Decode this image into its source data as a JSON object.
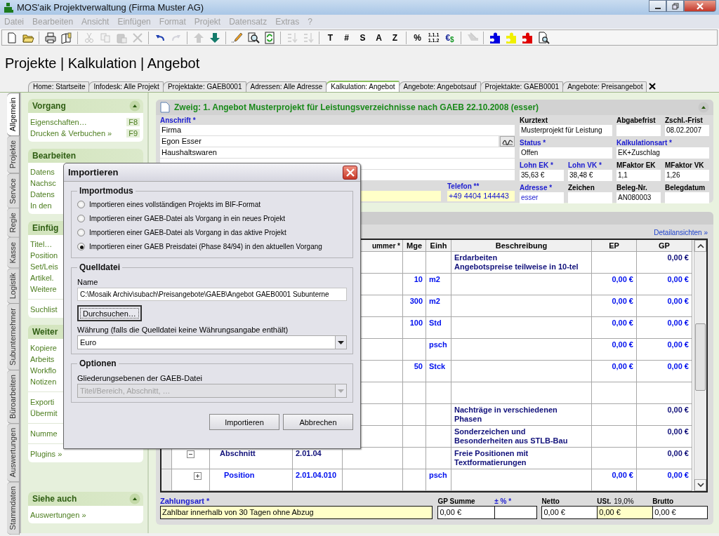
{
  "window": {
    "title": "MOS'aik Projektverwaltung (Firma Muster AG)"
  },
  "menu": [
    {
      "label": "Datei",
      "disabled": true
    },
    {
      "label": "Bearbeiten",
      "disabled": true
    },
    {
      "label": "Ansicht",
      "disabled": true
    },
    {
      "label": "Einfügen",
      "disabled": true
    },
    {
      "label": "Format",
      "disabled": true
    },
    {
      "label": "Projekt",
      "disabled": true
    },
    {
      "label": "Datensatz",
      "disabled": true
    },
    {
      "label": "Extras",
      "disabled": true
    },
    {
      "label": "?",
      "disabled": true
    }
  ],
  "toolbar": [
    {
      "kind": "new",
      "disabled": false
    },
    {
      "kind": "open",
      "disabled": false
    },
    {
      "kind": "separator"
    },
    {
      "kind": "print",
      "disabled": false
    },
    {
      "kind": "preview",
      "disabled": false
    },
    {
      "kind": "separator"
    },
    {
      "kind": "cut",
      "disabled": true
    },
    {
      "kind": "copy",
      "disabled": true
    },
    {
      "kind": "paste",
      "disabled": true
    },
    {
      "kind": "delete",
      "disabled": true
    },
    {
      "kind": "separator"
    },
    {
      "kind": "undo",
      "disabled": false
    },
    {
      "kind": "redo",
      "disabled": true
    },
    {
      "kind": "separator"
    },
    {
      "kind": "up",
      "disabled": true
    },
    {
      "kind": "down",
      "disabled": false
    },
    {
      "kind": "separator"
    },
    {
      "kind": "edit",
      "disabled": false
    },
    {
      "kind": "find",
      "disabled": false
    },
    {
      "kind": "refresh",
      "disabled": false
    },
    {
      "kind": "separator"
    },
    {
      "kind": "sort-az",
      "disabled": true
    },
    {
      "kind": "sort-za",
      "disabled": true
    },
    {
      "kind": "separator"
    },
    {
      "kind": "text",
      "label": "T",
      "disabled": false
    },
    {
      "kind": "text",
      "label": "#",
      "disabled": false
    },
    {
      "kind": "text",
      "label": "S",
      "disabled": false
    },
    {
      "kind": "text",
      "label": "A",
      "disabled": false
    },
    {
      "kind": "text",
      "label": "Z",
      "disabled": false
    },
    {
      "kind": "separator"
    },
    {
      "kind": "text",
      "label": "%",
      "disabled": false
    },
    {
      "kind": "stack",
      "lines": [
        "1.1.1",
        "1.1.2"
      ],
      "disabled": false
    },
    {
      "kind": "currency",
      "labels": [
        "€",
        "$"
      ],
      "disabled": false
    },
    {
      "kind": "separator"
    },
    {
      "kind": "tool",
      "disabled": true
    },
    {
      "kind": "separator"
    },
    {
      "kind": "puzzle",
      "color": "#0000e0",
      "disabled": false
    },
    {
      "kind": "puzzle",
      "color": "#f0f000",
      "disabled": false
    },
    {
      "kind": "puzzle",
      "color": "#e00000",
      "disabled": false
    },
    {
      "kind": "find-doc",
      "disabled": false
    }
  ],
  "heading": "Projekte | Kalkulation | Angebot",
  "tabs": [
    {
      "label": "Home: Startseite",
      "selected": false
    },
    {
      "label": "Infodesk: Alle Projekt",
      "selected": false
    },
    {
      "label": "Projektakte: GAEB0001",
      "selected": false
    },
    {
      "label": "Adressen: Alle Adresse",
      "selected": false
    },
    {
      "label": "Kalkulation: Angebot",
      "selected": true
    },
    {
      "label": "Angebote: Angebotsauf",
      "selected": false
    },
    {
      "label": "Projektakte: GAEB0001",
      "selected": false
    },
    {
      "label": "Angebote: Preisangebot",
      "selected": false
    }
  ],
  "side_tabs": [
    {
      "label": "Allgemein",
      "selected": true
    },
    {
      "label": "Projekte",
      "selected": false
    },
    {
      "label": "Service",
      "selected": false
    },
    {
      "label": "Regie",
      "selected": false
    },
    {
      "label": "Kasse",
      "selected": false
    },
    {
      "label": "Logistik",
      "selected": false
    },
    {
      "label": "Subunternehmer",
      "selected": false
    },
    {
      "label": "Büroarbeiten",
      "selected": false
    },
    {
      "label": "Auswertungen",
      "selected": false
    },
    {
      "label": "Stammdaten",
      "selected": false
    }
  ],
  "task_pane": [
    {
      "title": "Vorgang",
      "groups": [
        [
          {
            "label": "Eigenschaften…",
            "shortcut": "F8"
          },
          {
            "label": "Drucken & Verbuchen »",
            "shortcut": "F9"
          }
        ]
      ]
    },
    {
      "title": "Bearbeiten",
      "groups": [
        [
          {
            "label": "Datens"
          },
          {
            "label": "Nachsc"
          },
          {
            "label": "Datens"
          },
          {
            "label": "In den"
          }
        ]
      ]
    },
    {
      "title": "Einfüg",
      "groups": [
        [
          {
            "label": "Titel…"
          },
          {
            "label": "Position"
          },
          {
            "label": "Set/Leis"
          },
          {
            "label": "Artikel."
          },
          {
            "label": "Weitere"
          }
        ],
        [
          {
            "label": "Suchlist"
          }
        ]
      ]
    },
    {
      "title": "Weiter",
      "groups": [
        [
          {
            "label": "Kopiere"
          },
          {
            "label": "Arbeits"
          },
          {
            "label": "Workflo"
          },
          {
            "label": "Notizen"
          }
        ],
        [
          {
            "label": "Exporti"
          },
          {
            "label": "Übermit"
          }
        ],
        [
          {
            "label": "Numme"
          }
        ],
        [
          {
            "label": "Plugins »"
          }
        ]
      ]
    },
    {
      "title": "Siehe auch",
      "groups": [
        [
          {
            "label": "Auswertungen »"
          }
        ]
      ]
    }
  ],
  "branch": {
    "title": "Zweig: 1. Angebot Musterprojekt für Leistungsverzeichnisse nach GAEB 22.10.2008 (esser)",
    "address_label": "Anschrift *",
    "address_lines": [
      "Firma",
      "Egon Esser",
      "Haushaltswaren"
    ],
    "phone_label": "Telefon **",
    "phone_value": "+49 4404 144443",
    "fields": [
      {
        "label": "Kurztext",
        "value": "Musterprojekt für Leistung",
        "required": false,
        "link": false
      },
      {
        "label": "Abgabefrist",
        "required": false
      },
      {
        "label": "Zschl.-Frist",
        "value": "08.02.2007",
        "required": false,
        "link": false
      },
      {
        "label": "Status *",
        "value": "Offen",
        "required": true,
        "link": false
      },
      {
        "label": "Kalkulationsart *",
        "value": "EK+Zuschlag",
        "required": true,
        "link": false
      },
      {
        "label": "Lohn EK *",
        "value": "35,63 €",
        "required": true,
        "link": false
      },
      {
        "label": "Lohn VK *",
        "value": "38,48 €",
        "required": true,
        "link": false
      },
      {
        "label": "MFaktor EK",
        "value": "1,1",
        "required": false,
        "link": false
      },
      {
        "label": "MFaktor VK",
        "value": "1,26",
        "required": false,
        "link": false
      },
      {
        "label": "Adresse *",
        "value": "esser",
        "required": true,
        "link": true
      },
      {
        "label": "Zeichen",
        "required": false
      },
      {
        "label": "Beleg-Nr.",
        "value": "AN080003",
        "required": false,
        "link": false
      },
      {
        "label": "Belegdatum",
        "required": false
      }
    ]
  },
  "details_link": "Detailansichten »",
  "table": {
    "columns": [
      "ummer *",
      "Mge",
      "Einh",
      "Beschreibung",
      "EP",
      "GP"
    ],
    "rows": [
      {
        "kind": "group",
        "description": "Erdarbeiten\nAngebotspreise teilweise in 10-tel",
        "gp": "0,00 €"
      },
      {
        "kind": "item",
        "qty": "10",
        "unit": "m2",
        "ep": "0,00 €",
        "gp": "0,00 €"
      },
      {
        "kind": "item",
        "qty": "300",
        "unit": "m2",
        "ep": "0,00 €",
        "gp": "0,00 €"
      },
      {
        "kind": "item",
        "qty": "100",
        "unit": "Std",
        "ep": "0,00 €",
        "gp": "0,00 €"
      },
      {
        "kind": "item",
        "unit": "psch",
        "ep": "0,00 €",
        "gp": "0,00 €"
      },
      {
        "kind": "item",
        "qty": "50",
        "unit": "Stck",
        "ep": "0,00 €",
        "gp": "0,00 €"
      },
      {
        "kind": "item"
      },
      {
        "kind": "group",
        "description": "Nachträge in verschiedenen\nPhasen",
        "gp": "0,00 €"
      },
      {
        "kind": "group",
        "description": "Sonderzeichen und\nBesonderheiten aus STLB-Bau",
        "gp": "0,00 €"
      },
      {
        "kind": "group",
        "type": "Abschnitt",
        "number": "2.01.04",
        "expanded": true,
        "description": "Freie Positionen mit\nTextformatierungen",
        "gp": "0,00 €"
      },
      {
        "kind": "item",
        "type": "Position",
        "number": "2.01.04.010",
        "expanded": false,
        "unit": "psch",
        "ep": "0,00 €",
        "gp": "0,00 €"
      }
    ]
  },
  "footer": {
    "payment_label": "Zahlungsart *",
    "payment_value": "Zahlbar innerhalb von 30 Tagen ohne Abzug",
    "gp_label": "GP Summe",
    "gp_value": "0,00 €",
    "pct_label": "± % *",
    "net_label": "Netto",
    "net_value": "0,00 €",
    "vat_label": "USt.",
    "vat_rate": "19,0%",
    "vat_value": "0,00 €",
    "gross_label": "Brutto",
    "gross_value": "0,00 €"
  },
  "dialog": {
    "title": "Importieren",
    "mode_legend": "Importmodus",
    "modes": [
      {
        "label": "Importieren eines vollständigen Projekts im BIF-Format",
        "selected": false
      },
      {
        "label": "Importieren einer GAEB-Datei als Vorgang in ein neues Projekt",
        "selected": false
      },
      {
        "label": "Importieren einer GAEB-Datei als Vorgang in das aktive Projekt",
        "selected": false
      },
      {
        "label": "Importieren einer GAEB Preisdatei (Phase 84/94) in den aktuellen Vorgang",
        "selected": true
      }
    ],
    "source_legend": "Quelldatei",
    "name_label": "Name",
    "name_value": "C:\\Mosaik Archiv\\subach\\Preisangebote\\GAEB\\Angebot GAEB0001 Subunterne",
    "browse": "Durchsuchen…",
    "currency_label": "Währung (falls die Quelldatei keine Währungsangabe enthält)",
    "currency_value": "Euro",
    "options_legend": "Optionen",
    "levels_label": "Gliederungsebenen der GAEB-Datei",
    "levels_value": "Titel/Bereich, Abschnitt, …",
    "levels_disabled": true,
    "buttons": [
      "Importieren",
      "Abbrechen"
    ]
  }
}
